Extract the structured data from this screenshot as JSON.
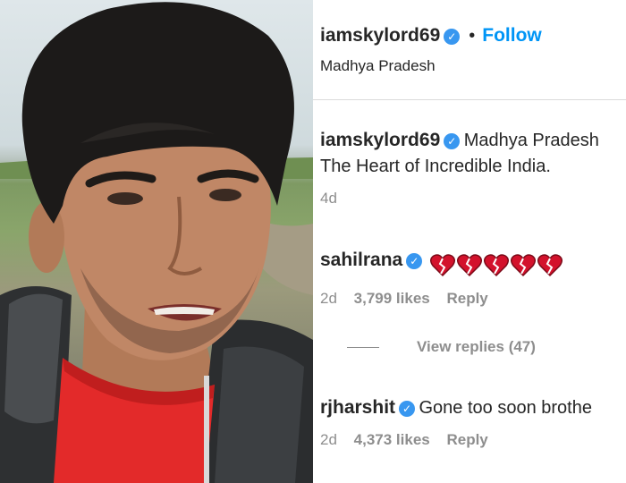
{
  "post": {
    "author": "iamskylord69",
    "separator": "•",
    "follow_label": "Follow",
    "location": "Madhya Pradesh"
  },
  "caption": {
    "username": "iamskylord69",
    "text_line1": "Madhya Pradesh",
    "text_line2": "The Heart of Incredible India.",
    "time": "4d"
  },
  "comments": [
    {
      "username": "sahilrana",
      "text": "",
      "emoji_icons": [
        "broken-heart-icon",
        "broken-heart-icon",
        "broken-heart-icon",
        "broken-heart-icon",
        "broken-heart-icon"
      ],
      "time": "2d",
      "likes": "3,799 likes",
      "reply_label": "Reply"
    },
    {
      "username": "rjharshit",
      "text": "Gone too soon brothe",
      "time": "2d",
      "likes": "4,373 likes",
      "reply_label": "Reply"
    }
  ],
  "view_replies_label": "View replies (47)",
  "colors": {
    "link_blue": "#0095f6",
    "verified_blue": "#3897f0",
    "meta_gray": "#8e8e8e",
    "heart_red": "#d3122c"
  }
}
